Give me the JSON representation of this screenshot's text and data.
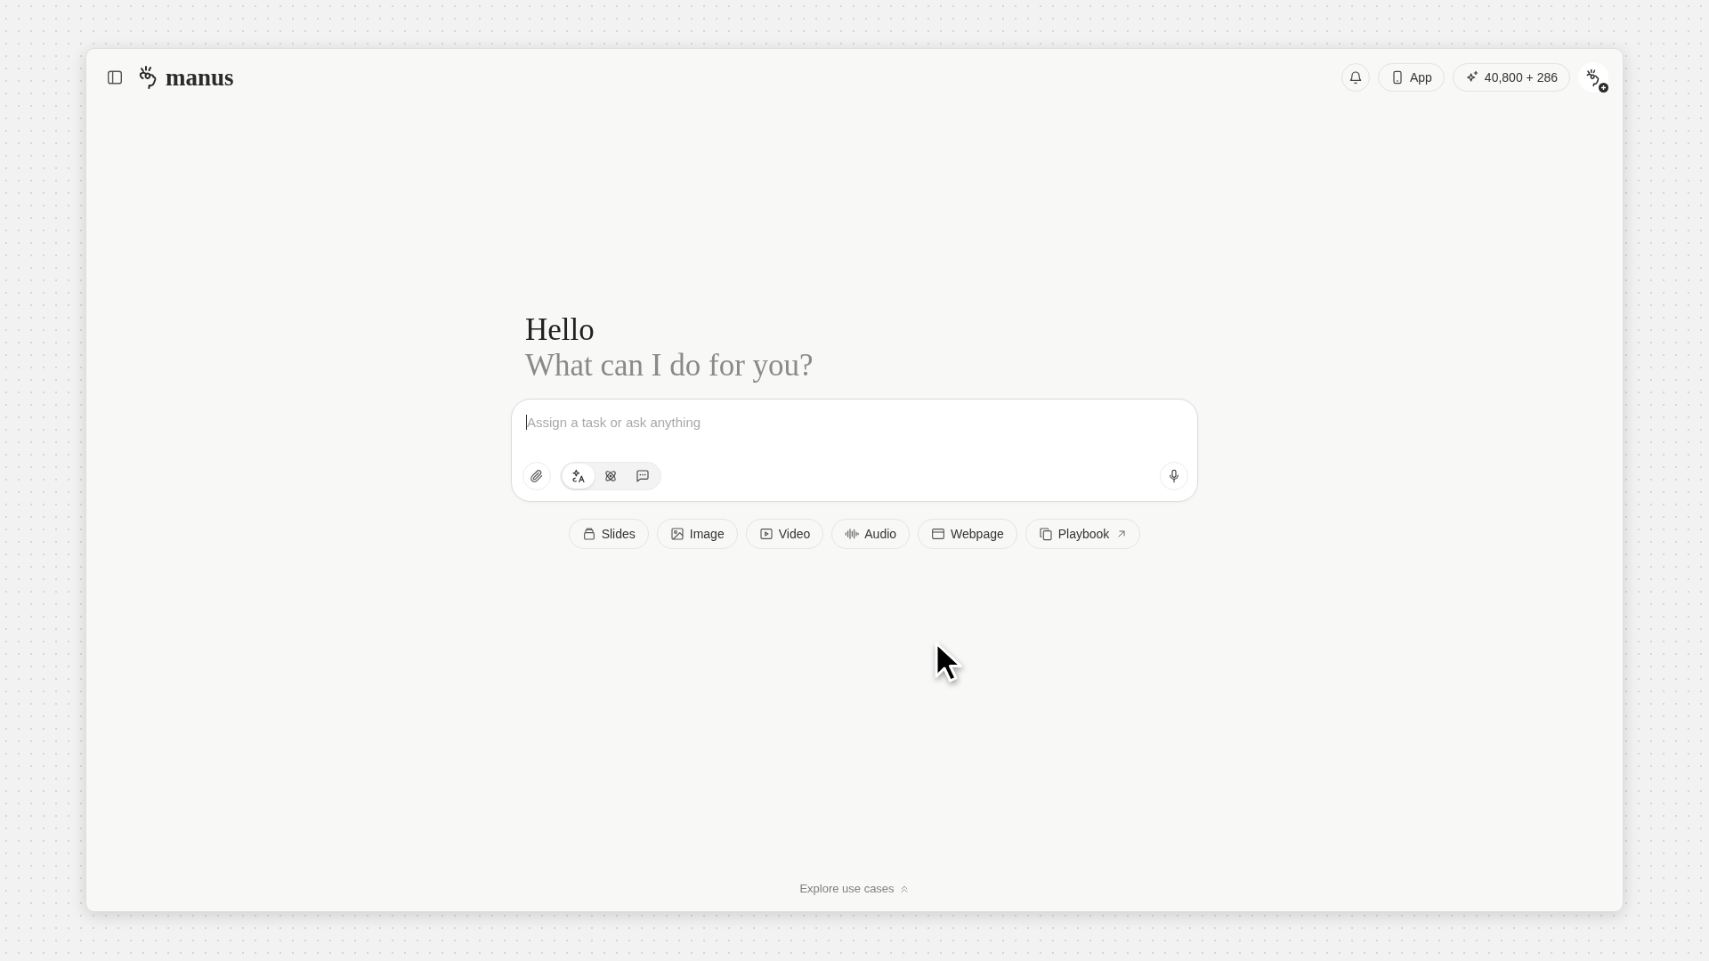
{
  "brand": {
    "name": "manus"
  },
  "top_bar": {
    "app_button": "App",
    "credits": "40,800 + 286"
  },
  "greeting": {
    "title": "Hello",
    "subtitle": "What can I do for you?"
  },
  "composer": {
    "placeholder": "Assign a task or ask anything",
    "modes": [
      {
        "kind": "sparkle",
        "selected": true
      },
      {
        "kind": "atom",
        "selected": false
      },
      {
        "kind": "chat",
        "selected": false
      }
    ]
  },
  "quick_actions": [
    {
      "kind": "slides",
      "label": "Slides",
      "external": false
    },
    {
      "kind": "image",
      "label": "Image",
      "external": false
    },
    {
      "kind": "video",
      "label": "Video",
      "external": false
    },
    {
      "kind": "audio",
      "label": "Audio",
      "external": false
    },
    {
      "kind": "webpage",
      "label": "Webpage",
      "external": false
    },
    {
      "kind": "playbook",
      "label": "Playbook",
      "external": true
    }
  ],
  "footer": {
    "link": "Explore use cases"
  }
}
